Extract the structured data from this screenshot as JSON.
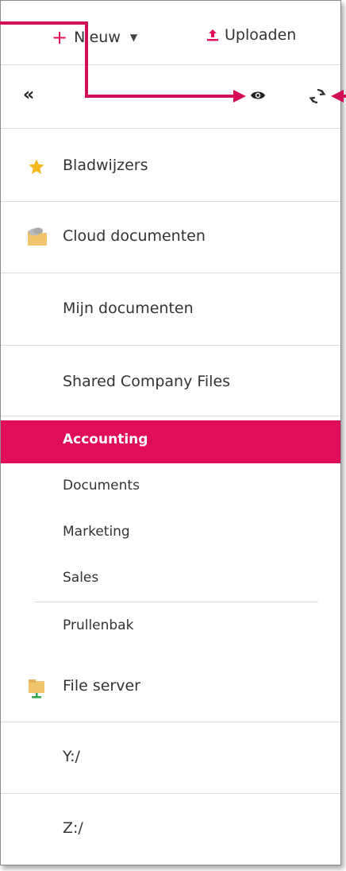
{
  "toolbar": {
    "new_label": "Nieuw",
    "upload_label": "Uploaden"
  },
  "panel": {
    "collapse_label": "«"
  },
  "nav": {
    "bookmarks": "Bladwijzers",
    "cloud": "Cloud documenten",
    "my_docs": "Mijn documenten",
    "shared": "Shared Company Files",
    "shared_items": [
      "Accounting",
      "Documents",
      "Marketing",
      "Sales"
    ],
    "trash": "Prullenbak",
    "file_server": "File server",
    "drive_y": "Y:/",
    "drive_z": "Z:/"
  },
  "colors": {
    "accent": "#e00d5a",
    "star": "#f5b81c",
    "folder": "#f1c56b",
    "cloud_folder": "#b0b0b0"
  },
  "active_item": "Accounting"
}
